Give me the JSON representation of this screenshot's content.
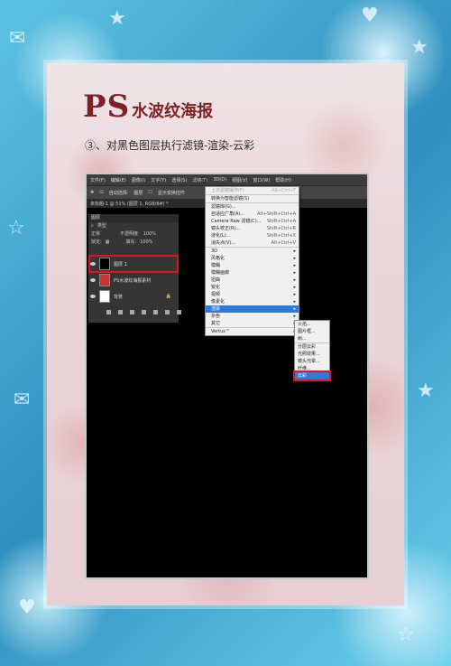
{
  "title": {
    "ps": "PS",
    "rest": "水波纹海报"
  },
  "subtitle": "③、对黑色图层执行滤镜-渲染-云彩",
  "menubar": [
    "文件(F)",
    "编辑(E)",
    "图像(I)",
    "文字(Y)",
    "选择(S)",
    "滤镜(T)",
    "3D(D)",
    "视图(V)",
    "窗口(W)",
    "帮助(H)"
  ],
  "optbar": [
    "自动选择:",
    "图层",
    "显示变换控件"
  ],
  "doc_tab": "未标题-1 @ 51% (图层 1, RGB/8#) *",
  "layers_panel": {
    "header": "图层",
    "kind": "类型",
    "blend": "正常",
    "opacity_label": "不透明度:",
    "opacity": "100%",
    "lock_label": "锁定:",
    "fill_label": "填充:",
    "fill": "100%",
    "items": [
      {
        "name": "图层 1"
      },
      {
        "name": "PS水波纹海报素材"
      },
      {
        "name": "背景"
      }
    ]
  },
  "filter_menu": [
    {
      "label": "上次滤镜操作(F)",
      "shortcut": "Alt+Ctrl+F",
      "disabled": true,
      "sep": true
    },
    {
      "label": "转换为智能滤镜(S)",
      "shortcut": "",
      "sep": true
    },
    {
      "label": "滤镜库(G)...",
      "shortcut": ""
    },
    {
      "label": "自适应广角(A)...",
      "shortcut": "Alt+Shift+Ctrl+A"
    },
    {
      "label": "Camera Raw 滤镜(C)...",
      "shortcut": "Shift+Ctrl+A"
    },
    {
      "label": "镜头校正(R)...",
      "shortcut": "Shift+Ctrl+R"
    },
    {
      "label": "液化(L)...",
      "shortcut": "Shift+Ctrl+X"
    },
    {
      "label": "消失点(V)...",
      "shortcut": "Alt+Ctrl+V",
      "sep": true
    },
    {
      "label": "3D",
      "arrow": true
    },
    {
      "label": "风格化",
      "arrow": true
    },
    {
      "label": "模糊",
      "arrow": true
    },
    {
      "label": "模糊画廊",
      "arrow": true
    },
    {
      "label": "扭曲",
      "arrow": true
    },
    {
      "label": "锐化",
      "arrow": true
    },
    {
      "label": "视频",
      "arrow": true
    },
    {
      "label": "像素化",
      "arrow": true
    },
    {
      "label": "渲染",
      "arrow": true,
      "selected": true
    },
    {
      "label": "杂色",
      "arrow": true
    },
    {
      "label": "其它",
      "arrow": true,
      "sep": true
    },
    {
      "label": "Vertus™",
      "arrow": true
    }
  ],
  "render_submenu": [
    {
      "label": "火焰..."
    },
    {
      "label": "图片框..."
    },
    {
      "label": "树...",
      "sep": true
    },
    {
      "label": "分层云彩"
    },
    {
      "label": "光照效果..."
    },
    {
      "label": "镜头光晕..."
    },
    {
      "label": "纤维..."
    },
    {
      "label": "云彩",
      "selected": true
    }
  ]
}
